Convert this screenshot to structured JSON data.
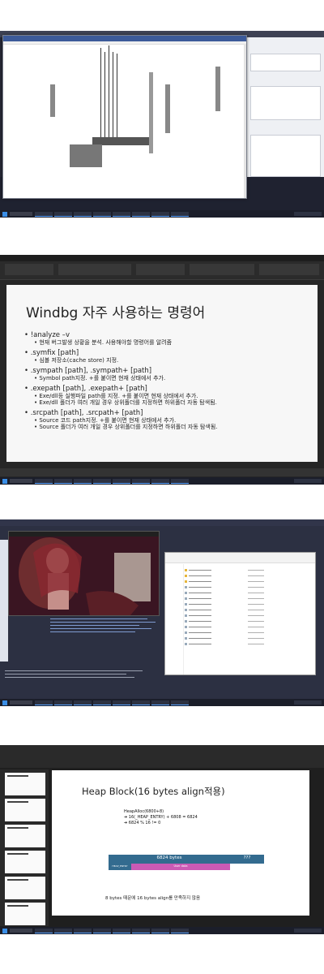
{
  "shots": [
    {
      "name": "debugger-screen"
    },
    {
      "name": "windbg-slide",
      "title": "Windbg 자주 사용하는 명령어",
      "items": [
        {
          "cmd": "!analyze –v",
          "desc": [
            "현재 버그발생 상황을 분석. 사용해야할 명령어를 알려줌"
          ]
        },
        {
          "cmd": ".symfix [path]",
          "desc": [
            "심볼 저장소(cache store) 지정."
          ]
        },
        {
          "cmd": ".sympath [path], .sympath+ [path]",
          "desc": [
            "Symbol path지정. +를 붙이면 현재 상태에서 추가."
          ]
        },
        {
          "cmd": ".exepath [path], .exepath+ [path]",
          "desc": [
            "Exe/dll등 실행파일 path를 지정. +를 붙이면 현재 상태에서 추가.",
            "Exe/dll 폴더가 여러 개일 경우 상위폴더를 지정하면 하위폴더 자동 탐색됨."
          ]
        },
        {
          "cmd": ".srcpath [path], .srcpath+ [path]",
          "desc": [
            "Source 코드 path지정. +를 붙이면 현재 상태에서 추가.",
            "Source 폴더가 여러 개일 경우 상위폴더를 지정하면 하위폴더 자동 탐색됨."
          ]
        }
      ]
    },
    {
      "name": "desktop-screen"
    },
    {
      "name": "heap-slide",
      "title": "Heap Block(16 bytes align적용)",
      "code": [
        "HeapAlloc(6800+8)",
        "➔ 16(_HEAP_ENTRY) + 6808 = 6824",
        "➔ 6824 % 16 != 0"
      ],
      "block_label": "6824 bytes",
      "header_label": "HEAP_ENTRY",
      "user_label": "User data",
      "unknown_label": "???",
      "note": "8 bytes 때문에 16 bytes align를 만족하지 않음"
    }
  ]
}
